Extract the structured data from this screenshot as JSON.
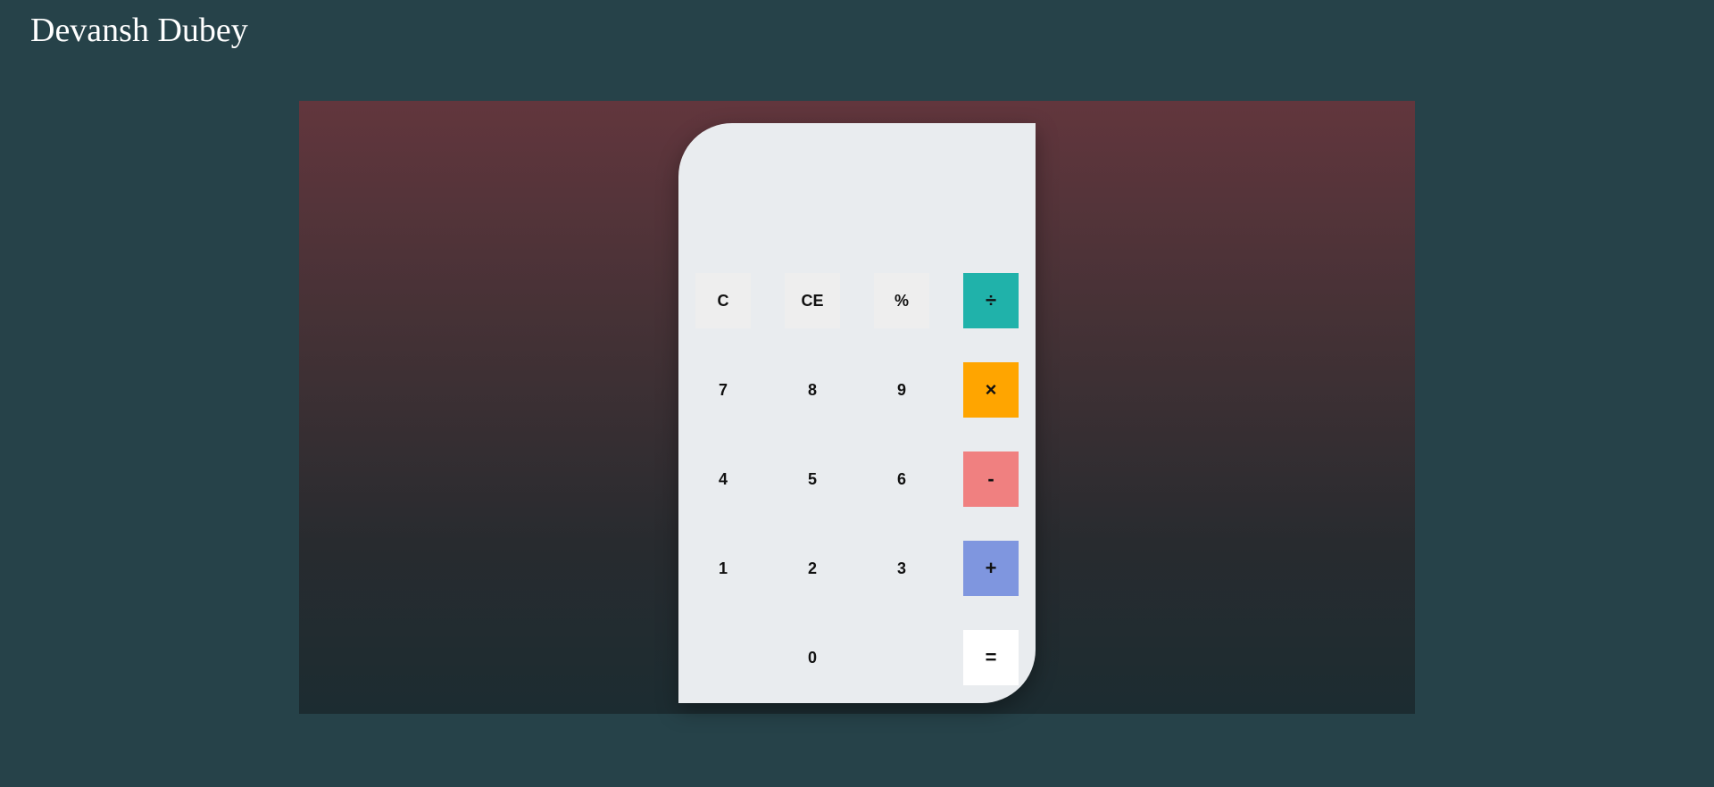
{
  "header": {
    "title": "Devansh Dubey"
  },
  "calculator": {
    "display_value": "",
    "keys": {
      "clear": "C",
      "clear_entry": "CE",
      "percent": "%",
      "divide": "÷",
      "seven": "7",
      "eight": "8",
      "nine": "9",
      "multiply": "×",
      "four": "4",
      "five": "5",
      "six": "6",
      "subtract": "-",
      "one": "1",
      "two": "2",
      "three": "3",
      "add": "+",
      "zero": "0",
      "equals": "="
    }
  },
  "colors": {
    "page_background": "#264249",
    "calculator_body": "#e9ecef",
    "divide_key": "#20b2aa",
    "multiply_key": "#ffa500",
    "subtract_key": "#f08080",
    "add_key": "#7f96df",
    "equals_key": "#ffffff",
    "function_key": "#eeeeee"
  }
}
